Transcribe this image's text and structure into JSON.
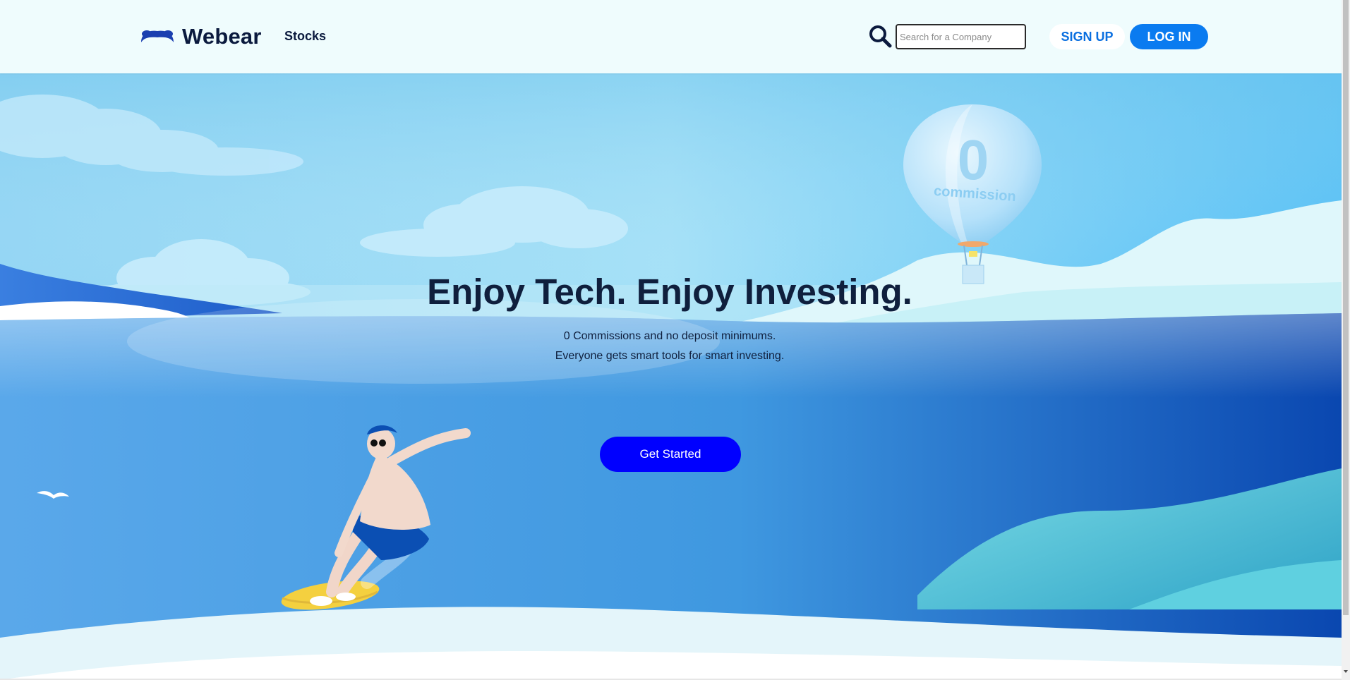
{
  "brand": {
    "name": "Webear",
    "logo_icon": "bear-ears-logo-icon"
  },
  "nav": {
    "stocks": "Stocks"
  },
  "search": {
    "placeholder": "Search for a Company",
    "value": "",
    "icon": "search-icon"
  },
  "auth": {
    "signup": "SIGN UP",
    "login": "LOG IN"
  },
  "hero": {
    "title": "Enjoy Tech. Enjoy Investing.",
    "subtitle_line1": "0 Commissions and no deposit minimums.",
    "subtitle_line2": "Everyone gets smart tools for smart investing.",
    "cta": "Get Started"
  },
  "balloon": {
    "number": "0",
    "word": "commission"
  },
  "colors": {
    "header_bg": "#effcfd",
    "brand_text": "#0b1a3e",
    "login_bg": "#0a7bf0",
    "signup_text": "#0a6fe0",
    "cta_bg": "#0000ff",
    "sky": "#7fd0f5",
    "sea_deep": "#0a4fb8"
  }
}
